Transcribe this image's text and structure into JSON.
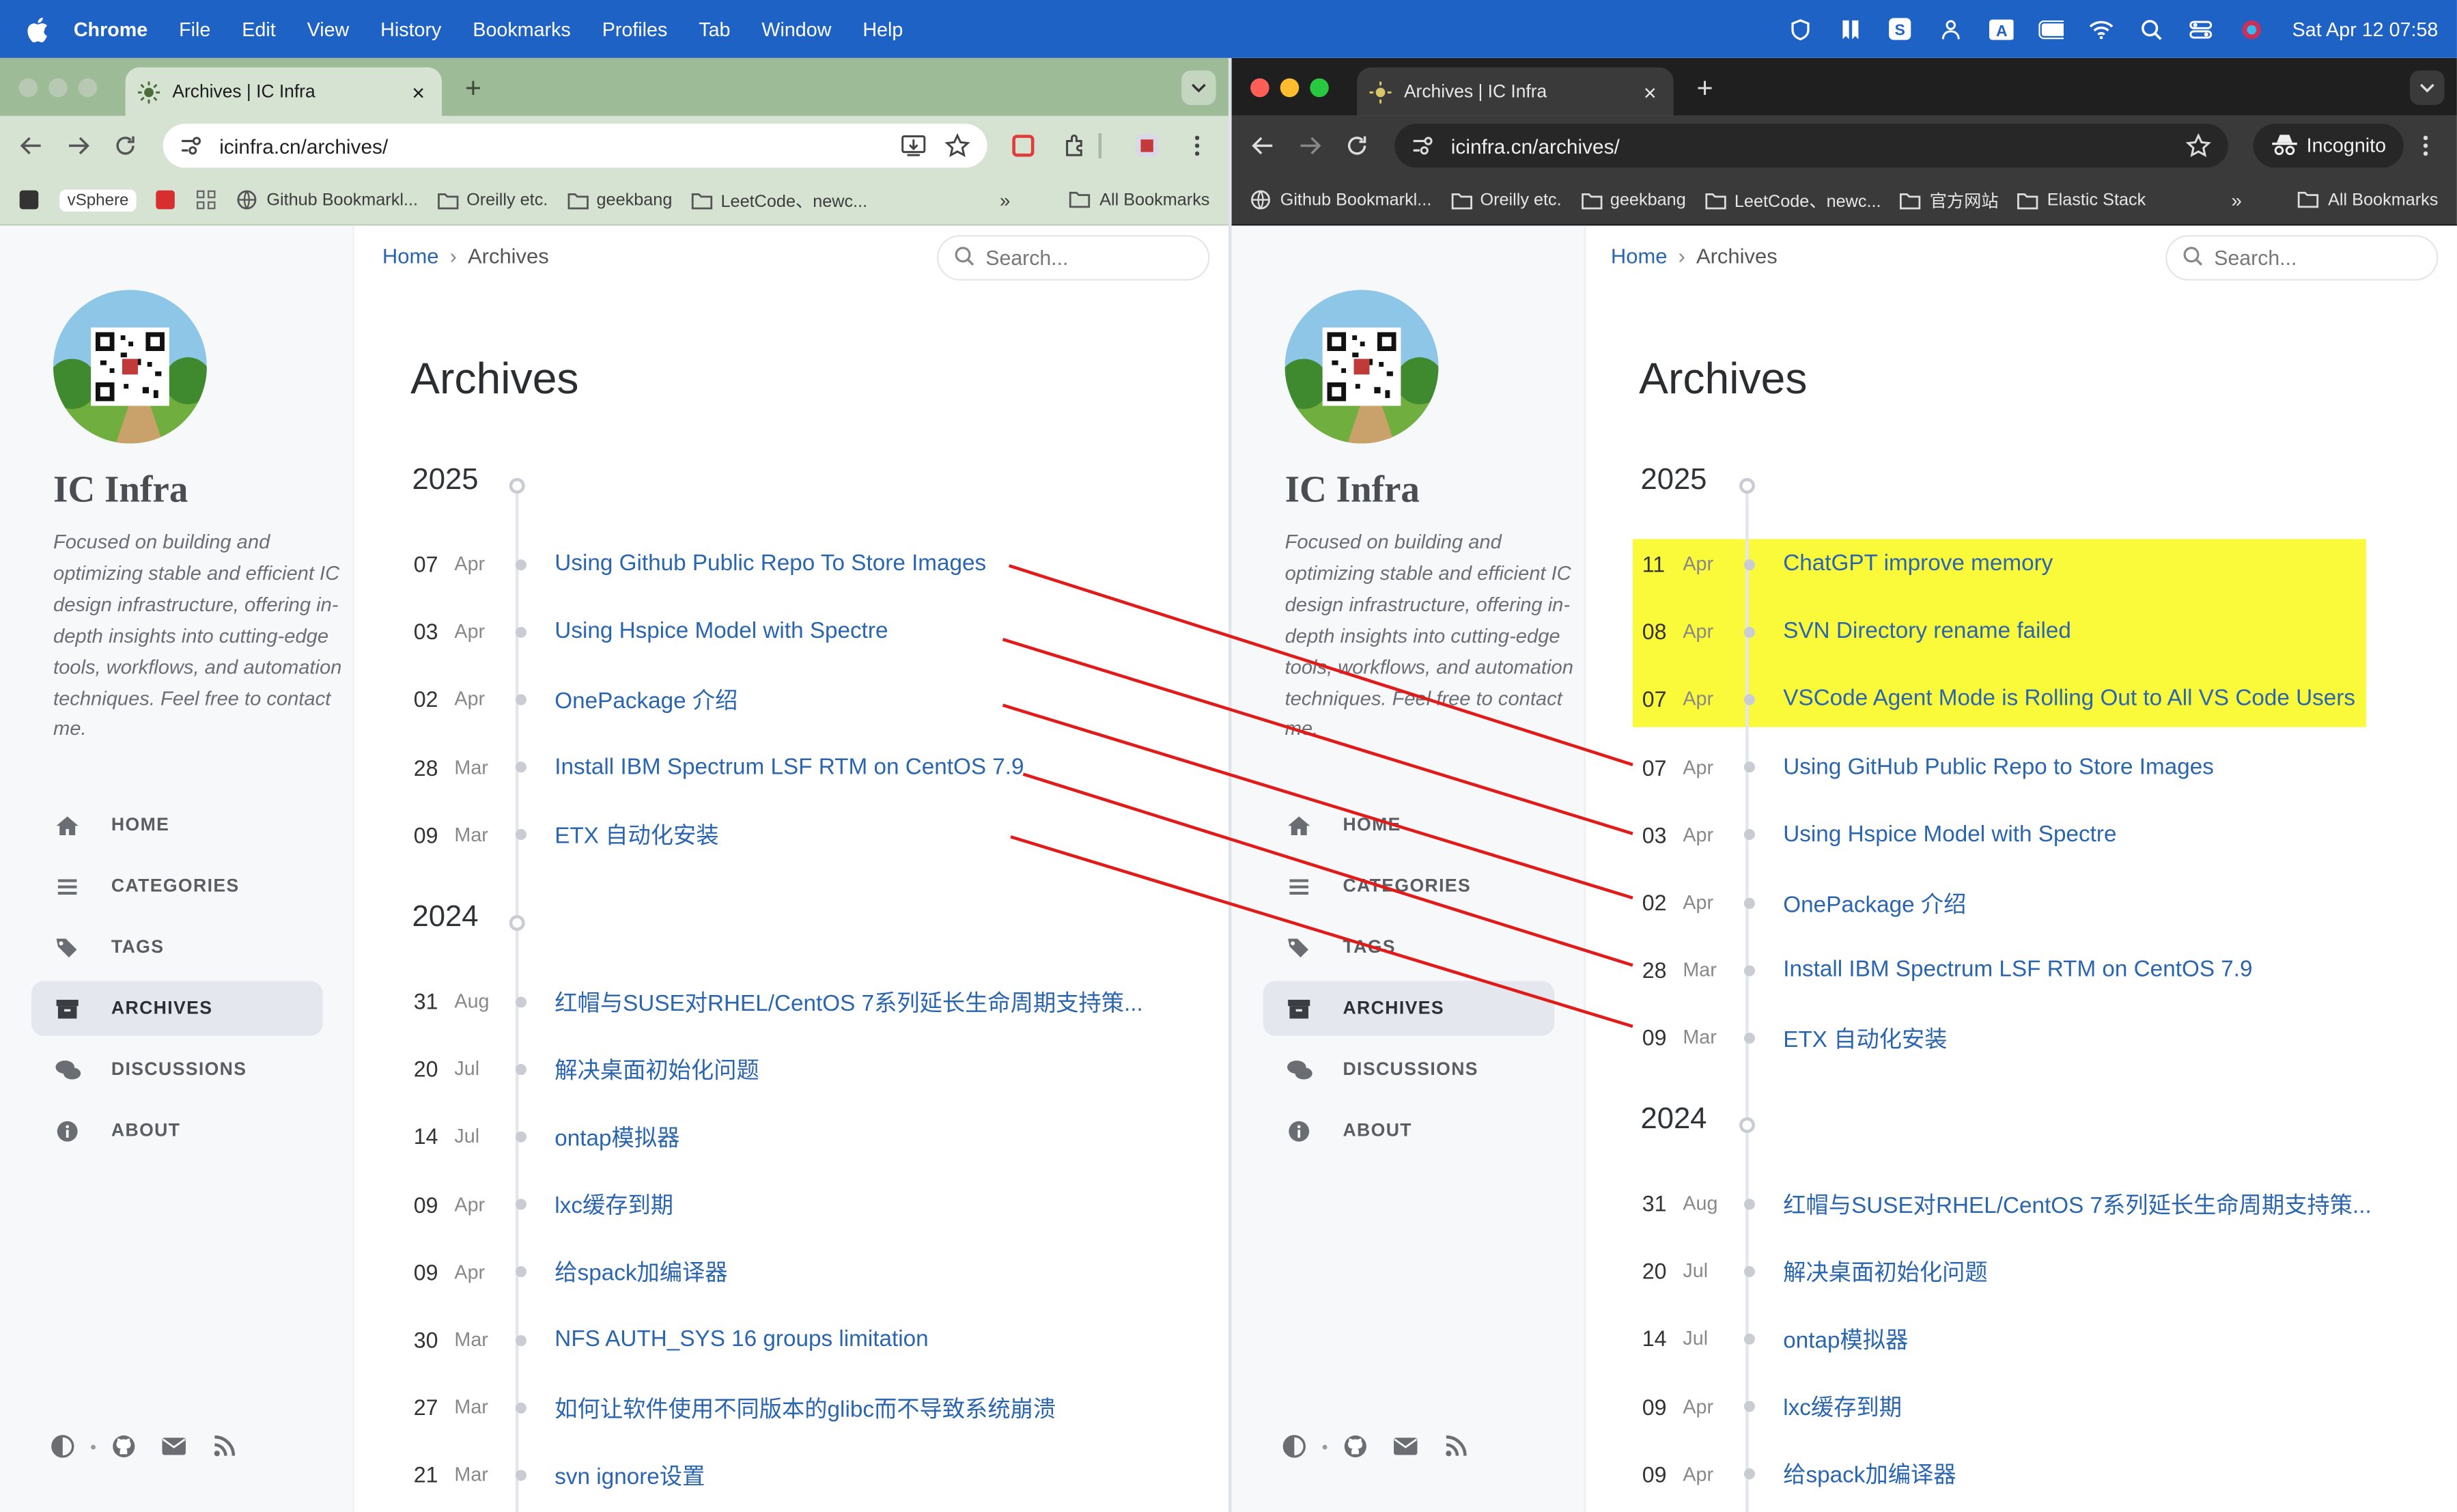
{
  "menubar": {
    "app": "Chrome",
    "menus": [
      "File",
      "Edit",
      "View",
      "History",
      "Bookmarks",
      "Profiles",
      "Tab",
      "Window",
      "Help"
    ],
    "clock": "Sat Apr 12  07:58"
  },
  "left_window": {
    "tab_title": "Archives | IC Infra",
    "url": "icinfra.cn/archives/",
    "bookmarks": [
      "vSphere",
      "Github Bookmarkl...",
      "Oreilly etc.",
      "geekbang",
      "LeetCode、newc..."
    ],
    "all_bookmarks": "All Bookmarks"
  },
  "right_window": {
    "tab_title": "Archives | IC Infra",
    "url": "icinfra.cn/archives/",
    "incognito": "Incognito",
    "bookmarks": [
      "Github Bookmarkl...",
      "Oreilly etc.",
      "geekbang",
      "LeetCode、newc...",
      "官方网站",
      "Elastic Stack"
    ],
    "all_bookmarks": "All Bookmarks"
  },
  "site": {
    "title": "IC Infra",
    "subtitle": "Focused on building and optimizing stable and efficient IC design infrastructure, offering in-depth insights into cutting-edge tools, workflows, and automation techniques. Feel free to contact me.",
    "nav": [
      "HOME",
      "CATEGORIES",
      "TAGS",
      "ARCHIVES",
      "DISCUSSIONS",
      "ABOUT"
    ],
    "active_nav": "ARCHIVES",
    "breadcrumb_home": "Home",
    "breadcrumb_current": "Archives",
    "search_placeholder": "Search...",
    "heading": "Archives"
  },
  "left_archive": {
    "year1": "2025",
    "posts_2025": [
      {
        "day": "07",
        "mon": "Apr",
        "title": "Using Github Public Repo To Store Images"
      },
      {
        "day": "03",
        "mon": "Apr",
        "title": "Using Hspice Model with Spectre"
      },
      {
        "day": "02",
        "mon": "Apr",
        "title": "OnePackage 介绍"
      },
      {
        "day": "28",
        "mon": "Mar",
        "title": "Install IBM Spectrum LSF RTM on CentOS 7.9"
      },
      {
        "day": "09",
        "mon": "Mar",
        "title": "ETX 自动化安装"
      }
    ],
    "year2": "2024",
    "posts_2024": [
      {
        "day": "31",
        "mon": "Aug",
        "title": "红帽与SUSE对RHEL/CentOS 7系列延长生命周期支持策..."
      },
      {
        "day": "20",
        "mon": "Jul",
        "title": "解决桌面初始化问题"
      },
      {
        "day": "14",
        "mon": "Jul",
        "title": "ontap模拟器"
      },
      {
        "day": "09",
        "mon": "Apr",
        "title": "lxc缓存到期"
      },
      {
        "day": "09",
        "mon": "Apr",
        "title": "给spack加编译器"
      },
      {
        "day": "30",
        "mon": "Mar",
        "title": "NFS AUTH_SYS 16 groups limitation"
      },
      {
        "day": "27",
        "mon": "Mar",
        "title": "如何让软件使用不同版本的glibc而不导致系统崩溃"
      },
      {
        "day": "21",
        "mon": "Mar",
        "title": "svn ignore设置"
      }
    ]
  },
  "right_archive": {
    "year1": "2025",
    "posts_2025": [
      {
        "day": "11",
        "mon": "Apr",
        "title": "ChatGPT improve memory"
      },
      {
        "day": "08",
        "mon": "Apr",
        "title": "SVN Directory rename failed"
      },
      {
        "day": "07",
        "mon": "Apr",
        "title": "VSCode Agent Mode is Rolling Out to All VS Code Users"
      },
      {
        "day": "07",
        "mon": "Apr",
        "title": "Using GitHub Public Repo to Store Images"
      },
      {
        "day": "03",
        "mon": "Apr",
        "title": "Using Hspice Model with Spectre"
      },
      {
        "day": "02",
        "mon": "Apr",
        "title": "OnePackage 介绍"
      },
      {
        "day": "28",
        "mon": "Mar",
        "title": "Install IBM Spectrum LSF RTM on CentOS 7.9"
      },
      {
        "day": "09",
        "mon": "Mar",
        "title": "ETX 自动化安装"
      }
    ],
    "year2": "2024",
    "posts_2024": [
      {
        "day": "31",
        "mon": "Aug",
        "title": "红帽与SUSE对RHEL/CentOS 7系列延长生命周期支持策..."
      },
      {
        "day": "20",
        "mon": "Jul",
        "title": "解决桌面初始化问题"
      },
      {
        "day": "14",
        "mon": "Jul",
        "title": "ontap模拟器"
      },
      {
        "day": "09",
        "mon": "Apr",
        "title": "lxc缓存到期"
      },
      {
        "day": "09",
        "mon": "Apr",
        "title": "给spack加编译器"
      }
    ]
  },
  "colors": {
    "menubar": "#1f62c6",
    "link": "#2a65b0",
    "highlight": "#fbfa3a",
    "annotation_line": "#e11a1a"
  },
  "icons": {
    "left_tab_favicon": "sun-favicon-icon",
    "right_tab_favicon": "incognito-favicon-icon",
    "nav": [
      "home-icon",
      "bars-icon",
      "tags-icon",
      "archive-icon",
      "comments-icon",
      "info-icon"
    ],
    "footer": [
      "theme-toggle-icon",
      "github-icon",
      "email-icon",
      "rss-icon"
    ]
  }
}
